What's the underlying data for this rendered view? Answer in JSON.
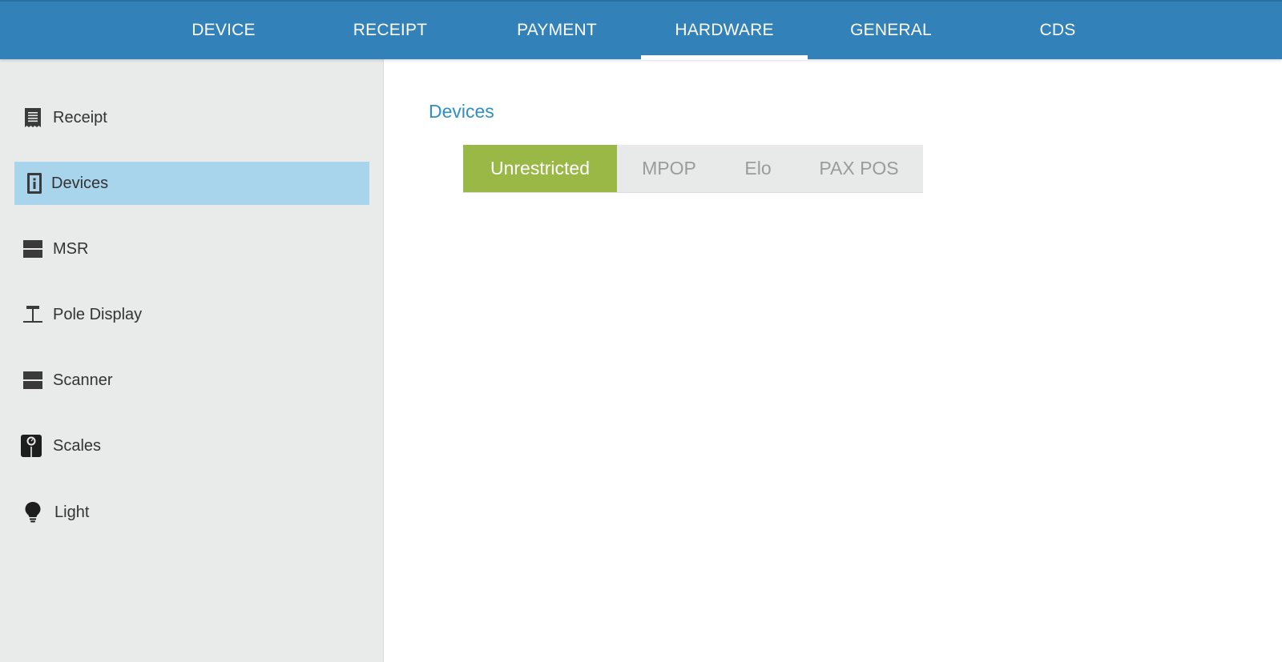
{
  "top_tabs": [
    {
      "label": "DEVICE"
    },
    {
      "label": "RECEIPT"
    },
    {
      "label": "PAYMENT"
    },
    {
      "label": "HARDWARE"
    },
    {
      "label": "GENERAL"
    },
    {
      "label": "CDS"
    }
  ],
  "active_tab": "HARDWARE",
  "sidebar": {
    "items": [
      {
        "label": "Receipt",
        "icon": "receipt-icon"
      },
      {
        "label": "Devices",
        "icon": "info-device-icon"
      },
      {
        "label": "MSR",
        "icon": "card-reader-icon"
      },
      {
        "label": "Pole Display",
        "icon": "pole-display-icon"
      },
      {
        "label": "Scanner",
        "icon": "scanner-icon"
      },
      {
        "label": "Scales",
        "icon": "scale-icon"
      },
      {
        "label": "Light",
        "icon": "light-bulb-icon"
      }
    ],
    "active_item": "Devices"
  },
  "content": {
    "section_title": "Devices",
    "segments": [
      {
        "label": "Unrestricted"
      },
      {
        "label": "MPOP"
      },
      {
        "label": "Elo"
      },
      {
        "label": "PAX POS"
      }
    ],
    "active_segment": "Unrestricted"
  },
  "colors": {
    "top_bar": "#3281b8",
    "sidebar_bg": "#e9ebea",
    "sidebar_active": "#a8d4ec",
    "section_title": "#2e8fc4",
    "segment_active": "#9ab846",
    "segment_bg": "#e8eaea"
  }
}
